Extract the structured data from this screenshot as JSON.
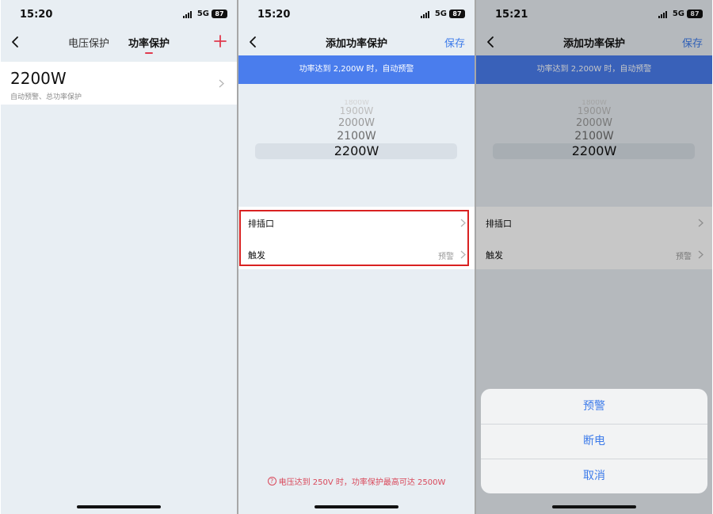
{
  "panel1": {
    "status": {
      "time": "15:20",
      "network": "5G",
      "battery": "87"
    },
    "tabs": [
      {
        "label": "电压保护"
      },
      {
        "label": "功率保护"
      }
    ],
    "card": {
      "value": "2200W",
      "subtitle": "自动预警、总功率保护"
    }
  },
  "panel2": {
    "status": {
      "time": "15:20",
      "network": "5G",
      "battery": "87"
    },
    "title": "添加功率保护",
    "save_label": "保存",
    "banner": "功率达到 2,200W 时，自动预警",
    "picker": [
      "1800W",
      "1900W",
      "2000W",
      "2100W",
      "2200W"
    ],
    "rows": [
      {
        "label": "排插口",
        "value": ""
      },
      {
        "label": "触发",
        "value": "预警"
      }
    ],
    "footnote": "电压达到 250V 时，功率保护最高可达 2500W",
    "footnote_icon": "?"
  },
  "panel3": {
    "status": {
      "time": "15:21",
      "network": "5G",
      "battery": "87"
    },
    "title": "添加功率保护",
    "save_label": "保存",
    "banner": "功率达到 2,200W 时，自动预警",
    "picker": [
      "1800W",
      "1900W",
      "2000W",
      "2100W",
      "2200W"
    ],
    "rows": [
      {
        "label": "排插口",
        "value": ""
      },
      {
        "label": "触发",
        "value": "预警"
      }
    ],
    "action_sheet": [
      {
        "label": "预警"
      },
      {
        "label": "断电"
      },
      {
        "label": "取消"
      }
    ]
  },
  "colors": {
    "accent_blue": "#3d7bea",
    "banner_blue": "#4a7ded",
    "accent_red": "#e03a4e",
    "highlight_red": "#d92121",
    "background": "#e8eef3"
  }
}
